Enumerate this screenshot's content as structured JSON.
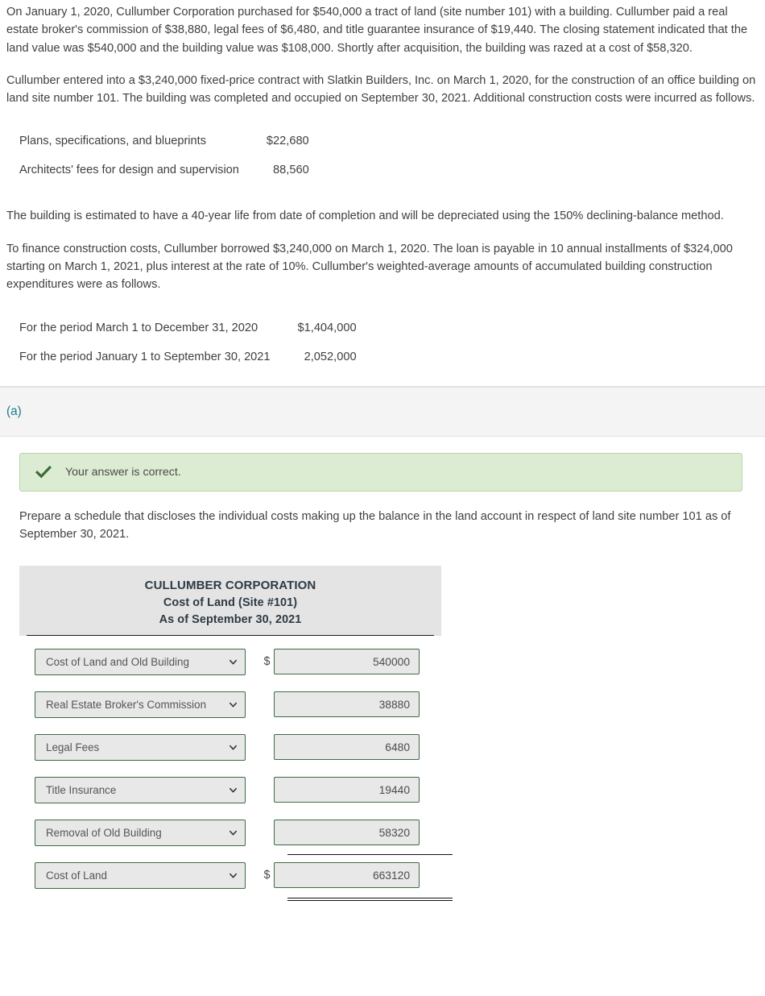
{
  "problem": {
    "paragraphs": [
      "On January 1, 2020, Cullumber Corporation purchased for $540,000 a tract of land (site number 101) with a building. Cullumber paid a real estate broker's commission of $38,880, legal fees of $6,480, and title guarantee insurance of $19,440. The closing statement indicated that the land value was $540,000 and the building value was $108,000. Shortly after acquisition, the building was razed at a cost of $58,320.",
      "Cullumber entered into a $3,240,000 fixed-price contract with Slatkin Builders, Inc. on March 1, 2020, for the construction of an office building on land site number 101. The building was completed and occupied on September 30, 2021. Additional construction costs were incurred as follows.",
      "The building is estimated to have a 40-year life from date of completion and will be depreciated using the 150% declining-balance method.",
      "To finance construction costs, Cullumber borrowed $3,240,000 on March 1, 2020. The loan is payable in 10 annual installments of $324,000 starting on March 1, 2021, plus interest at the rate of 10%. Cullumber's weighted-average amounts of accumulated building construction expenditures were as follows."
    ],
    "construction_costs": [
      {
        "label": "Plans, specifications, and blueprints",
        "amount": "$22,680"
      },
      {
        "label": "Architects' fees for design and supervision",
        "amount": "88,560"
      }
    ],
    "weighted_average": [
      {
        "label": "For the period March 1 to December 31, 2020",
        "amount": "$1,404,000"
      },
      {
        "label": "For the period January 1 to September 30, 2021",
        "amount": "2,052,000"
      }
    ]
  },
  "part": {
    "label": "(a)",
    "label_color": "#1c7a8c"
  },
  "banner": {
    "text": "Your answer is correct.",
    "icon": "check-icon",
    "background": "#dcecd2",
    "border": "#b9d7a6",
    "icon_color": "#3a6b35"
  },
  "instruction": "Prepare a schedule that discloses the individual costs making up the balance in the land account in respect of land site number 101 as of September 30, 2021.",
  "schedule": {
    "title_line1": "CULLUMBER CORPORATION",
    "title_line2": "Cost of Land (Site #101)",
    "title_line3": "As of September 30, 2021",
    "rows": [
      {
        "account": "Cost of Land and Old Building",
        "currency": "$",
        "amount": "540000",
        "rule": "none"
      },
      {
        "account": "Real Estate Broker's Commission",
        "currency": "",
        "amount": "38880",
        "rule": "none"
      },
      {
        "account": "Legal Fees",
        "currency": "",
        "amount": "6480",
        "rule": "none"
      },
      {
        "account": "Title Insurance",
        "currency": "",
        "amount": "19440",
        "rule": "none"
      },
      {
        "account": "Removal of Old Building",
        "currency": "",
        "amount": "58320",
        "rule": "single"
      },
      {
        "account": "Cost of Land",
        "currency": "$",
        "amount": "663120",
        "rule": "double"
      }
    ]
  }
}
